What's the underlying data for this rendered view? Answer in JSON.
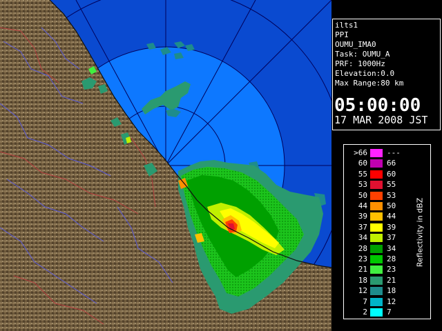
{
  "info_panel": {
    "station": "ilts1",
    "scan_mode": "PPI",
    "product": "OUMU_IMA0",
    "task": "Task: OUMU_A",
    "prf": "PRF: 1000Hz",
    "elevation": "Elevation:0.0",
    "max_range": "Max Range:80 km",
    "time": "05:00:00",
    "date": "17 MAR 2008 JST"
  },
  "legend": {
    "axis_label": "Reflectivity in dBZ",
    "rows": [
      {
        "lo": ">66",
        "hi": "---",
        "color": "#ff22ff"
      },
      {
        "lo": "60",
        "hi": "66",
        "color": "#c000b0"
      },
      {
        "lo": "55",
        "hi": "60",
        "color": "#ff0000"
      },
      {
        "lo": "53",
        "hi": "55",
        "color": "#e01030"
      },
      {
        "lo": "50",
        "hi": "53",
        "color": "#ff4000"
      },
      {
        "lo": "44",
        "hi": "50",
        "color": "#ff9000"
      },
      {
        "lo": "39",
        "hi": "44",
        "color": "#ffc000"
      },
      {
        "lo": "37",
        "hi": "39",
        "color": "#ffff00"
      },
      {
        "lo": "34",
        "hi": "37",
        "color": "#c0f000"
      },
      {
        "lo": "28",
        "hi": "34",
        "color": "#00a000"
      },
      {
        "lo": "23",
        "hi": "28",
        "color": "#00c800"
      },
      {
        "lo": "21",
        "hi": "23",
        "color": "#40f040"
      },
      {
        "lo": "18",
        "hi": "21",
        "color": "#2a9a70"
      },
      {
        "lo": "12",
        "hi": "18",
        "color": "#1e8c8c"
      },
      {
        "lo": "7",
        "hi": "12",
        "color": "#00b4c8"
      },
      {
        "lo": "2",
        "hi": "7",
        "color": "#00ffff"
      }
    ]
  },
  "colors": {
    "sea_near": "#0d78ff",
    "sea_far": "#0a4ad0",
    "land": "#6e5a3c",
    "range_ring": "#00005a"
  }
}
